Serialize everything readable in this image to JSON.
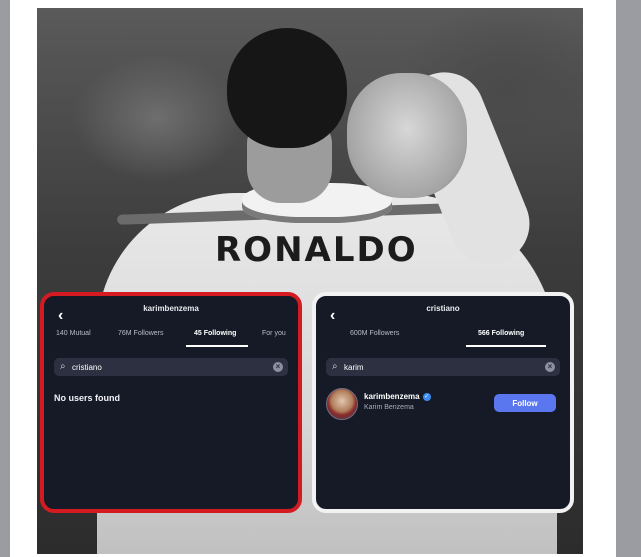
{
  "photo": {
    "jersey_text": "RONALDO"
  },
  "left_panel": {
    "username": "karimbenzema",
    "tabs": [
      {
        "label": "140 Mutual",
        "active": false
      },
      {
        "label": "76M Followers",
        "active": false
      },
      {
        "label": "45 Following",
        "active": true
      },
      {
        "label": "For you",
        "active": false
      }
    ],
    "search_value": "cristiano",
    "empty_message": "No users found",
    "border_color": "#d41b22"
  },
  "right_panel": {
    "username": "cristiano",
    "tabs": [
      {
        "label": "600M Followers",
        "active": false
      },
      {
        "label": "566 Following",
        "active": true
      }
    ],
    "search_value": "karim",
    "result": {
      "username": "karimbenzema",
      "full_name": "Karim Benzema",
      "verified": true,
      "action_label": "Follow"
    },
    "border_color": "#f2f2f2"
  },
  "colors": {
    "panel_bg": "#161a26",
    "follow_button": "#5b77f0"
  }
}
